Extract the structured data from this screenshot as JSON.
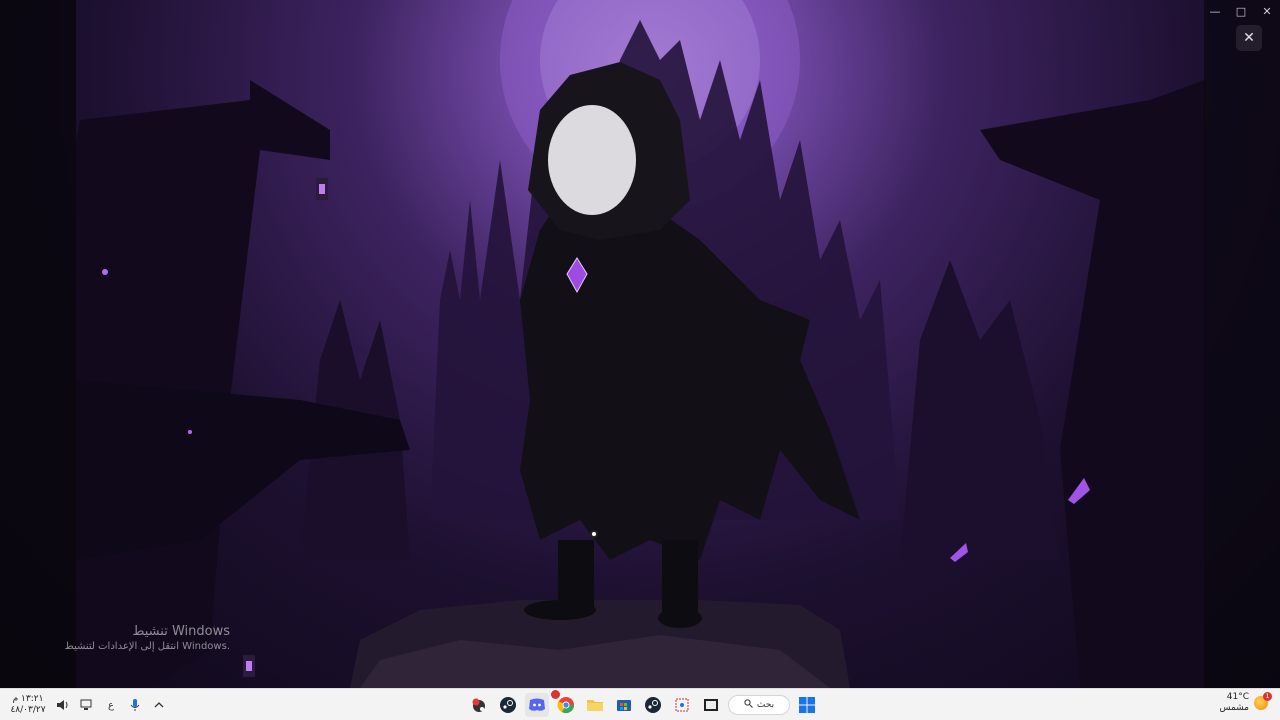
{
  "window": {
    "minimize_icon": "minimize-icon",
    "maximize_icon": "maximize-icon",
    "close_icon": "close-icon",
    "viewer_close_icon": "close-icon"
  },
  "watermark": {
    "title": "تنشيط Windows",
    "subtitle": "انتقل إلى الإعدادات لتنشيط Windows."
  },
  "taskbar": {
    "clock_time": "١٣:٢١",
    "clock_suffix": "م",
    "clock_date": "٤٨/٠٣/٢٧",
    "language": "ع",
    "search_label": "بحث",
    "weather_temp": "41°C",
    "weather_desc": "مشمس",
    "weather_badge": "1",
    "app_icons": [
      "windows-start-icon",
      "search-icon",
      "file-explorer-icon",
      "snipping-tool-icon",
      "steam-icon",
      "store-icon",
      "folder-icon",
      "chrome-icon",
      "discord-icon",
      "steam-icon",
      "other-app-icon"
    ]
  },
  "colors": {
    "taskbar_bg": "#f3f3f3",
    "accent_purple": "#7a4fb0",
    "start_blue": "#1a73e8"
  }
}
